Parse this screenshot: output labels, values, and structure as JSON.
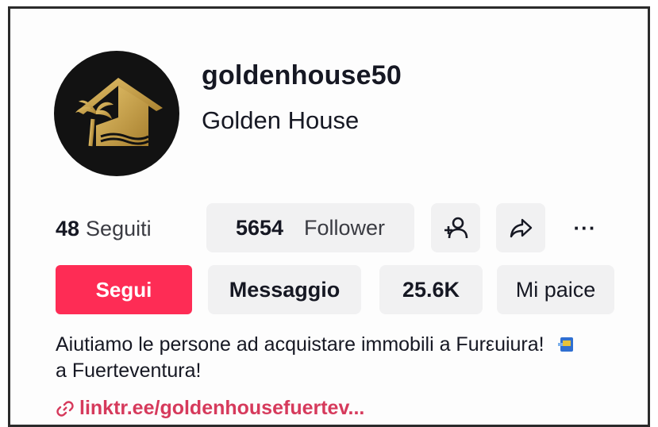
{
  "profile": {
    "handle": "goldenhouse50",
    "display_name": "Golden House",
    "following_count": "48",
    "following_label": "Seguiti",
    "follower_count": "5654",
    "follower_label": "Follower",
    "likes_count": "25.6K",
    "likes_label": "Mi paice",
    "bio_line1": "Aiutiamo le persone ad acquistare immobili a Furεuiura!",
    "bio_line2": "a Fuerteventura!",
    "link": "linktr.ee/goldenhousefuertev..."
  },
  "actions": {
    "follow_label": "Segui",
    "message_label": "Messaggio",
    "more_label": "···"
  },
  "icons": {
    "avatar": "golden-house-logo",
    "add_friend": "add-friend-icon",
    "share": "share-arrow-icon",
    "link": "link-icon",
    "bio_emoji": "flag-emoji-icon"
  },
  "colors": {
    "accent": "#fe2c55",
    "link": "#d63a5c",
    "pill": "#f1f1f2",
    "logo_gold": "#c9a24a"
  }
}
